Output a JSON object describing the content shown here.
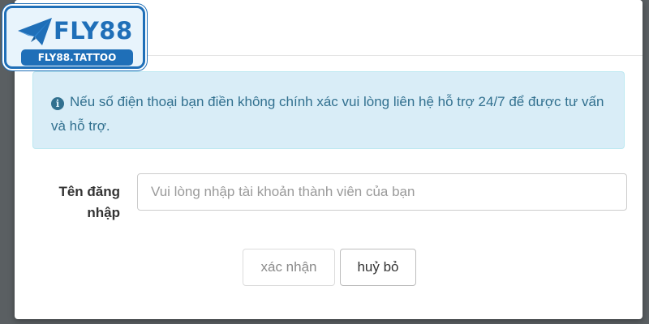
{
  "brand": {
    "name": "FLY88",
    "domain": "FLY88.TATTOO",
    "accent_color": "#1f6fb8",
    "icon": "paper-plane-icon"
  },
  "alert": {
    "icon": "info-circle-icon",
    "message": "Nếu số điện thoại bạn điền không chính xác vui lòng liên hệ hỗ trợ 24/7 để được tư vấn và hỗ trợ.",
    "background_color": "#d9edf7",
    "text_color": "#31708f"
  },
  "form": {
    "username_label": "Tên đăng nhập",
    "username_placeholder": "Vui lòng nhập tài khoản thành viên của bạn",
    "username_value": ""
  },
  "actions": {
    "confirm_label": "xác nhận",
    "cancel_label": "huỷ bỏ"
  }
}
